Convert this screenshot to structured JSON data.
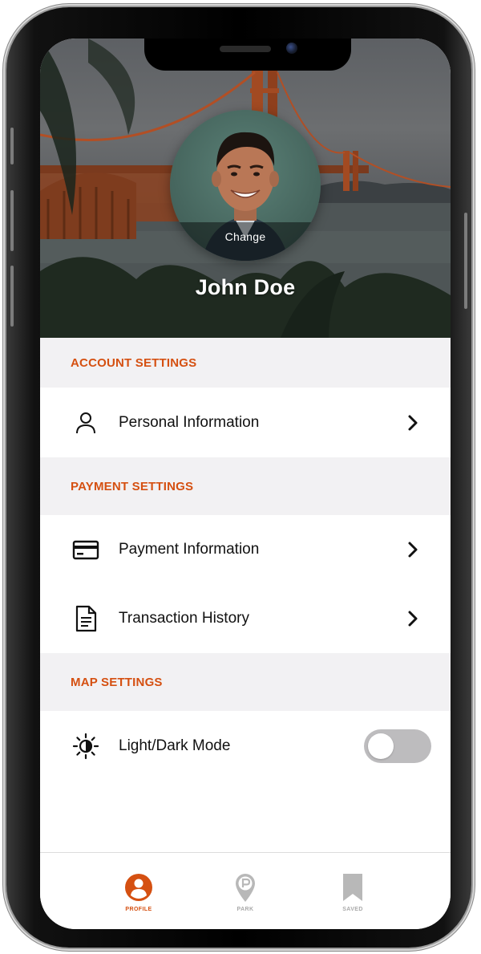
{
  "profile": {
    "name": "John Doe",
    "change_label": "Change"
  },
  "sections": {
    "account": {
      "title": "ACCOUNT SETTINGS",
      "items": [
        {
          "label": "Personal Information",
          "icon": "person-icon"
        }
      ]
    },
    "payment": {
      "title": "PAYMENT SETTINGS",
      "items": [
        {
          "label": "Payment Information",
          "icon": "credit-card-icon"
        },
        {
          "label": "Transaction History",
          "icon": "document-icon"
        }
      ]
    },
    "map": {
      "title": "MAP SETTINGS",
      "items": [
        {
          "label": "Light/Dark Mode",
          "icon": "brightness-icon",
          "toggle_on": false
        }
      ]
    }
  },
  "tabbar": {
    "tabs": [
      {
        "label": "PROFILE",
        "icon": "profile-icon",
        "active": true
      },
      {
        "label": "PARK",
        "icon": "park-pin-icon",
        "active": false
      },
      {
        "label": "SAVED",
        "icon": "bookmark-icon",
        "active": false
      }
    ]
  },
  "colors": {
    "accent": "#d55011",
    "section_bg": "#f2f1f3",
    "toggle_off": "#bdbcbe",
    "tab_inactive": "#a9a9a9"
  }
}
